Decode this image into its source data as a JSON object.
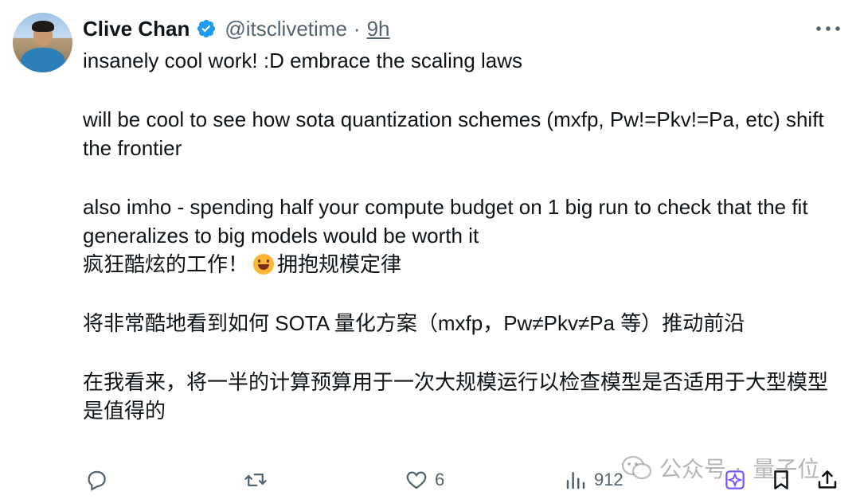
{
  "tweet": {
    "author_name": "Clive Chan",
    "handle": "@itsclivetime",
    "separator": "·",
    "time": "9h",
    "paragraphs_en": [
      "insanely cool work! :D embrace the scaling laws",
      "will be cool to see how sota quantization schemes (mxfp, Pw!=Pkv!=Pa, etc) shift the frontier",
      "also imho - spending half your compute budget on 1 big run to check that the fit generalizes to big models would be worth it"
    ],
    "zh_line1_before_emoji": "疯狂酷炫的工作！",
    "zh_line1_after_emoji": "拥抱规模定律",
    "zh_line2": "将非常酷地看到如何 SOTA 量化方案（mxfp，Pw≠Pkv≠Pa 等）推动前沿",
    "zh_line3": "在我看来，将一半的计算预算用于一次大规模运行以检查模型是否适用于大型模型是值得的"
  },
  "actions": {
    "likes": "6",
    "views": "912"
  },
  "icons": {
    "verified": "verified-badge-icon",
    "more": "more-options-icon",
    "reply": "reply-icon",
    "retweet": "retweet-icon",
    "like": "heart-icon",
    "views": "views-chart-icon",
    "grok": "grok-icon",
    "bookmark": "bookmark-icon",
    "share": "share-icon",
    "emoji": "grinning-face-emoji"
  },
  "watermark": {
    "left": "公众号",
    "right": "量子位"
  },
  "colors": {
    "text": "#0f1419",
    "muted": "#536471",
    "verified": "#1d9bf0"
  }
}
